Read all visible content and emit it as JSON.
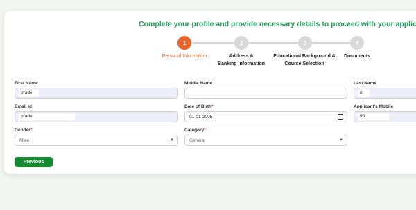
{
  "headline": "Complete your profile and provide necessary details to proceed with your application.",
  "steps": [
    {
      "number": "1",
      "label": "Personal Information",
      "active": true
    },
    {
      "number": "2",
      "label_line1": "Address &",
      "label_line2": "Banking Information"
    },
    {
      "number": "3",
      "label_line1": "Educational Background &",
      "label_line2": "Course Selection"
    },
    {
      "number": "4",
      "label": "Documents"
    }
  ],
  "form": {
    "first_name": {
      "label": "First Name",
      "value": "prade"
    },
    "middle_name": {
      "label": "Middle Name",
      "value": ""
    },
    "last_name": {
      "label": "Last Name",
      "value": "n"
    },
    "email": {
      "label": "Email Id",
      "value": "prade"
    },
    "dob": {
      "label": "Date of Birth",
      "required": "*",
      "value": "01-01-2005"
    },
    "mobile": {
      "label": "Applicant's Mobile",
      "value": "90"
    },
    "gender": {
      "label": "Gender",
      "required": "*",
      "value": "Male"
    },
    "category": {
      "label": "Category",
      "required": "*",
      "value": "General"
    }
  },
  "buttons": {
    "previous": "Previous"
  },
  "colors": {
    "accent_green": "#1f9d55",
    "active_step": "#e8642c",
    "button": "#138a2f"
  },
  "icons": [
    "chevron-down-icon",
    "calendar-icon"
  ]
}
